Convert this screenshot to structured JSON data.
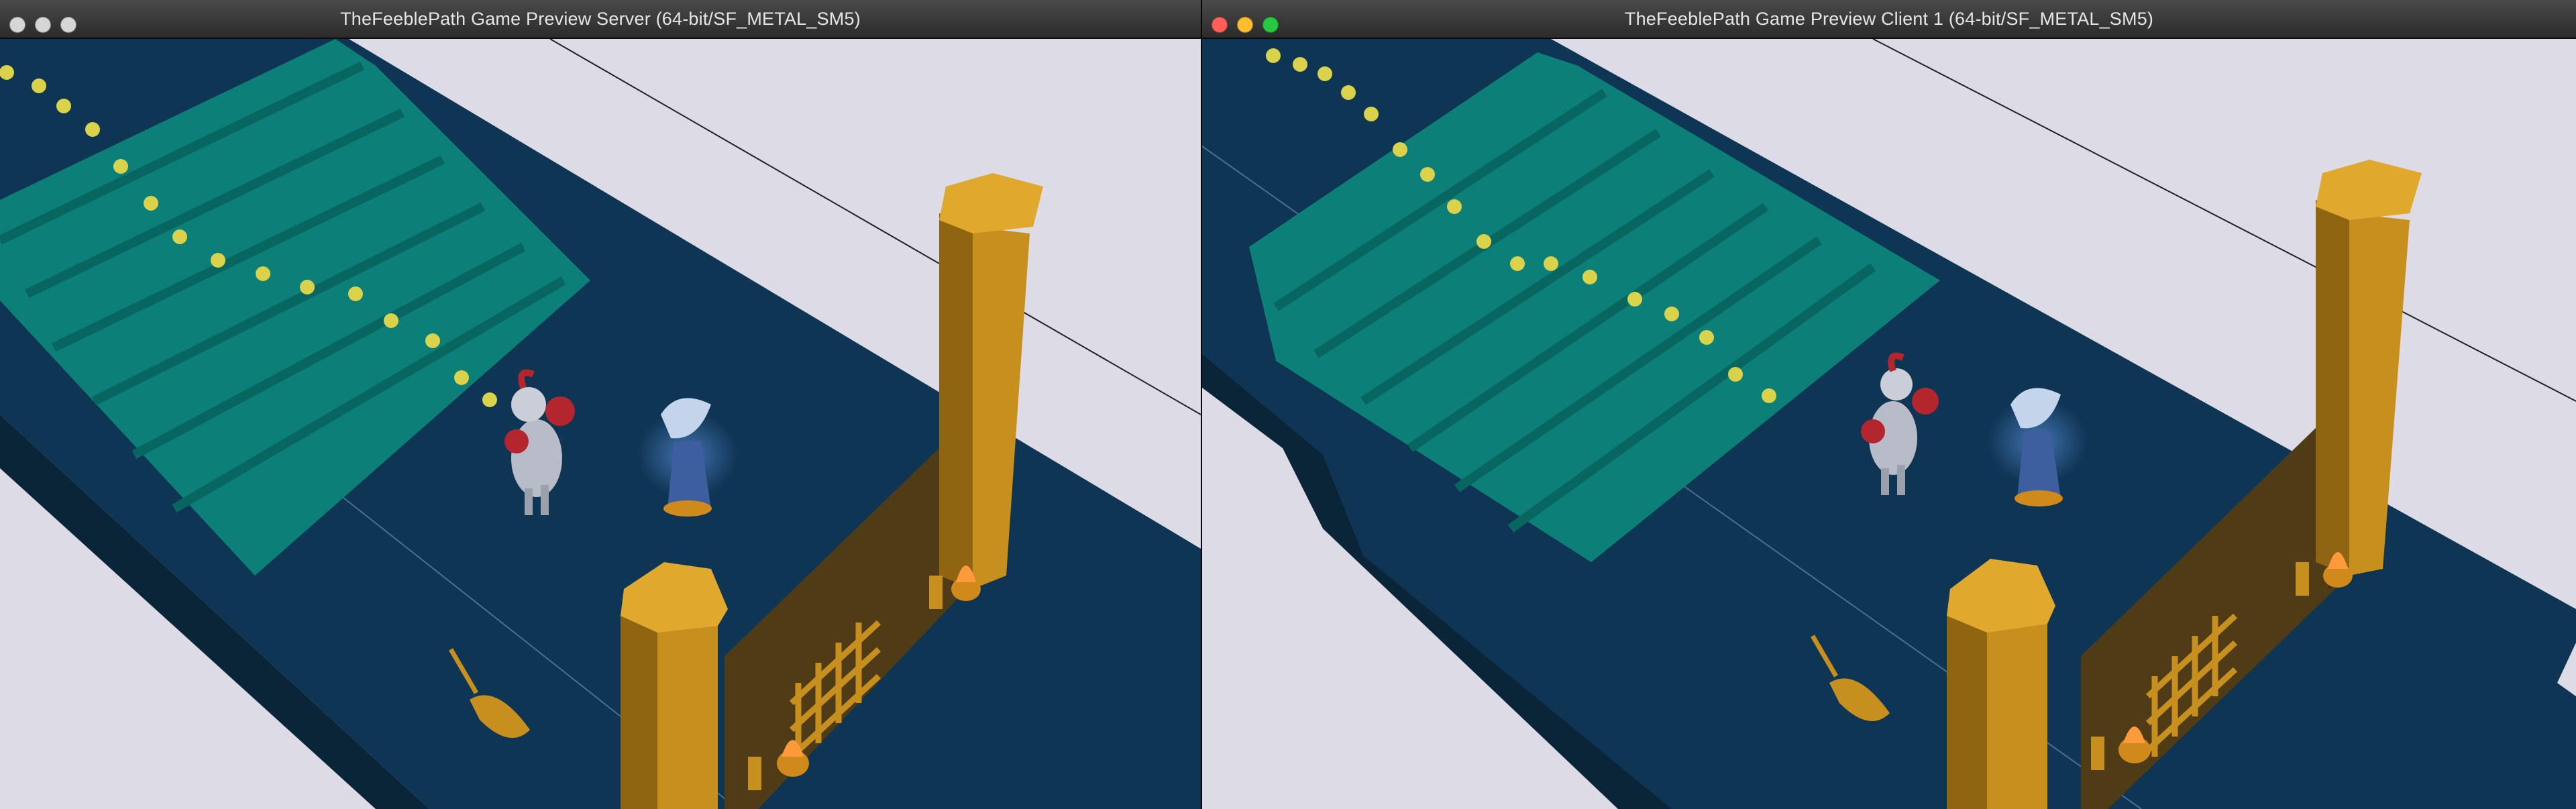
{
  "windows": {
    "server": {
      "title": "TheFeeblePath Game Preview Server (64-bit/SF_METAL_SM5)",
      "traffic_lights": [
        "grey",
        "grey",
        "grey"
      ]
    },
    "client": {
      "title": "TheFeeblePath Game Preview Client 1 (64-bit/SF_METAL_SM5)",
      "traffic_lights": [
        "red",
        "yellow",
        "green"
      ]
    }
  },
  "colors": {
    "background_plane": "#dcdbe6",
    "floor": "#0f3554",
    "floor_side": "#0a2538",
    "stairs": "#0b7f78",
    "stairs_dark": "#086660",
    "pillar": "#c7901e",
    "pillar_dark": "#8f6512",
    "gate": "#4f3c17",
    "torch_flame": "#ff9a3c",
    "path_dots": "#d9d24a",
    "knight_armor": "#b7bcc8",
    "knight_red": "#b3262e",
    "mage_blue": "#3d5fa0",
    "glow": "#6fa6ff"
  },
  "icons": [
    "window-close-icon",
    "window-minimize-icon",
    "window-zoom-icon"
  ]
}
